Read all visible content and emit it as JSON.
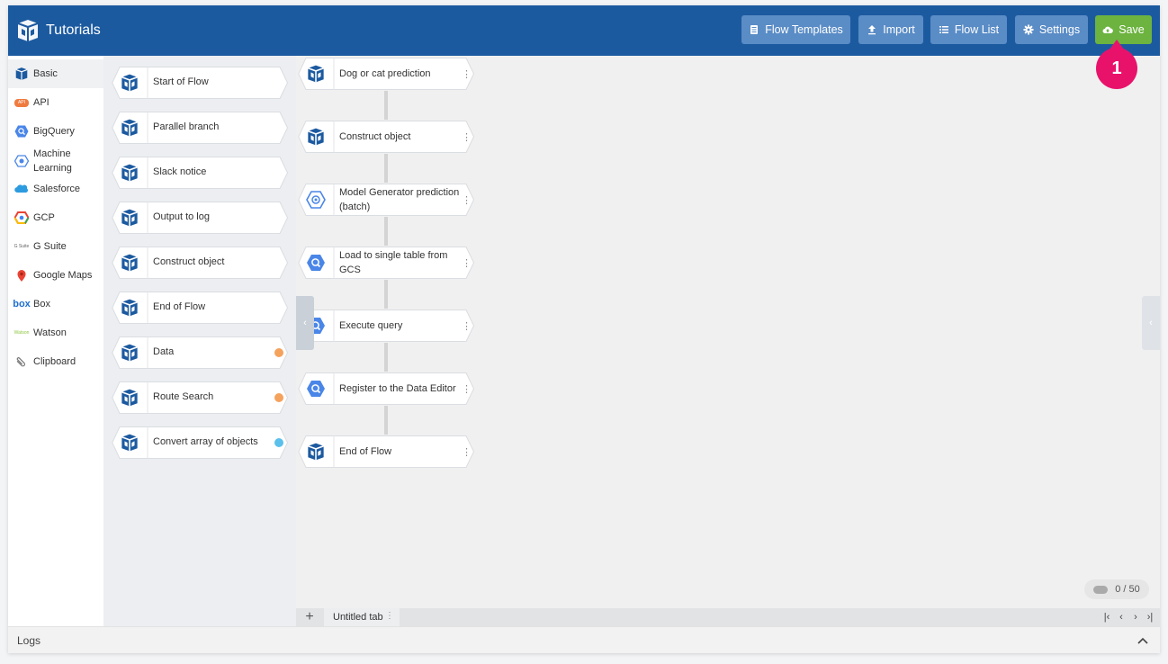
{
  "app": {
    "title": "Tutorials"
  },
  "toolbar": {
    "flow_templates": "Flow Templates",
    "import": "Import",
    "flow_list": "Flow List",
    "settings": "Settings",
    "save": "Save"
  },
  "callout": {
    "number": "1"
  },
  "sidebar": {
    "categories": [
      {
        "label": "Basic",
        "icon": "flow-logo-icon"
      },
      {
        "label": "API",
        "icon": "api-icon"
      },
      {
        "label": "BigQuery",
        "icon": "bigquery-icon"
      },
      {
        "label": "Machine Learning",
        "icon": "machine-learning-icon"
      },
      {
        "label": "Salesforce",
        "icon": "salesforce-icon"
      },
      {
        "label": "GCP",
        "icon": "gcp-icon"
      },
      {
        "label": "G Suite",
        "icon": "gsuite-icon"
      },
      {
        "label": "Google Maps",
        "icon": "google-maps-icon"
      },
      {
        "label": "Box",
        "icon": "box-icon"
      },
      {
        "label": "Watson",
        "icon": "watson-icon"
      },
      {
        "label": "Clipboard",
        "icon": "clipboard-icon"
      }
    ],
    "api_icon_text": "API",
    "gsuite_icon_text": "G Suite",
    "box_icon_text": "box",
    "watson_icon_text": "Watson"
  },
  "palette": {
    "items": [
      {
        "label": "Start of Flow"
      },
      {
        "label": "Parallel branch"
      },
      {
        "label": "Slack notice"
      },
      {
        "label": "Output to log"
      },
      {
        "label": "Construct object"
      },
      {
        "label": "End of Flow"
      },
      {
        "label": "Data",
        "badge_color": "#f5a25d"
      },
      {
        "label": "Route Search",
        "badge_color": "#f5a25d"
      },
      {
        "label": "Convert array of objects",
        "badge_color": "#5bc0eb"
      }
    ]
  },
  "flow": {
    "nodes": [
      {
        "label": "Dog or cat prediction",
        "icon": "flow-logo-icon"
      },
      {
        "label": "Construct object",
        "icon": "flow-logo-icon"
      },
      {
        "label": "Model Generator prediction (batch)",
        "icon": "machine-learning-icon"
      },
      {
        "label": "Load to single table from GCS",
        "icon": "bigquery-icon"
      },
      {
        "label": "Execute query",
        "icon": "bigquery-icon"
      },
      {
        "label": "Register to the Data Editor",
        "icon": "bigquery-icon"
      },
      {
        "label": "End of Flow",
        "icon": "flow-logo-icon"
      }
    ],
    "kebab": "⋮"
  },
  "canvas": {
    "counter": "0 / 50",
    "left_arrow": "‹",
    "right_arrow": "‹"
  },
  "tabs": {
    "add": "+",
    "items": [
      {
        "label": "Untitled tab"
      }
    ],
    "kebab": "⋮",
    "nav_first": "|‹",
    "nav_prev": "‹",
    "nav_next": "›",
    "nav_last": "›|"
  },
  "logs": {
    "label": "Logs"
  },
  "colors": {
    "header": "#1c5aa0",
    "button": "#5a8cc6",
    "save": "#6cb33f",
    "callout": "#e8126b",
    "bigquery": "#4a86e8"
  }
}
